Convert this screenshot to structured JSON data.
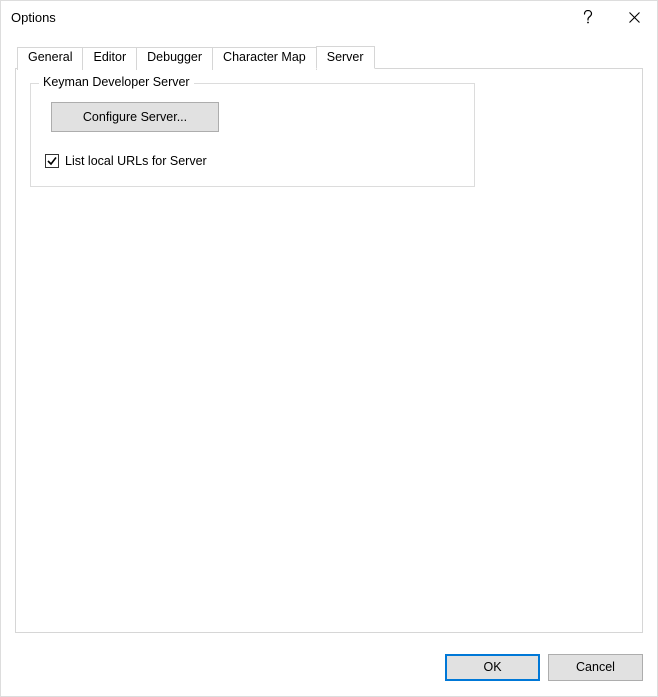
{
  "window": {
    "title": "Options"
  },
  "tabs": {
    "items": [
      {
        "label": "General"
      },
      {
        "label": "Editor"
      },
      {
        "label": "Debugger"
      },
      {
        "label": "Character Map"
      },
      {
        "label": "Server"
      }
    ],
    "active_index": 4
  },
  "server_panel": {
    "group_title": "Keyman Developer Server",
    "configure_button": "Configure Server...",
    "checkbox": {
      "label": "List local URLs for Server",
      "checked": true
    }
  },
  "buttons": {
    "ok": "OK",
    "cancel": "Cancel"
  }
}
